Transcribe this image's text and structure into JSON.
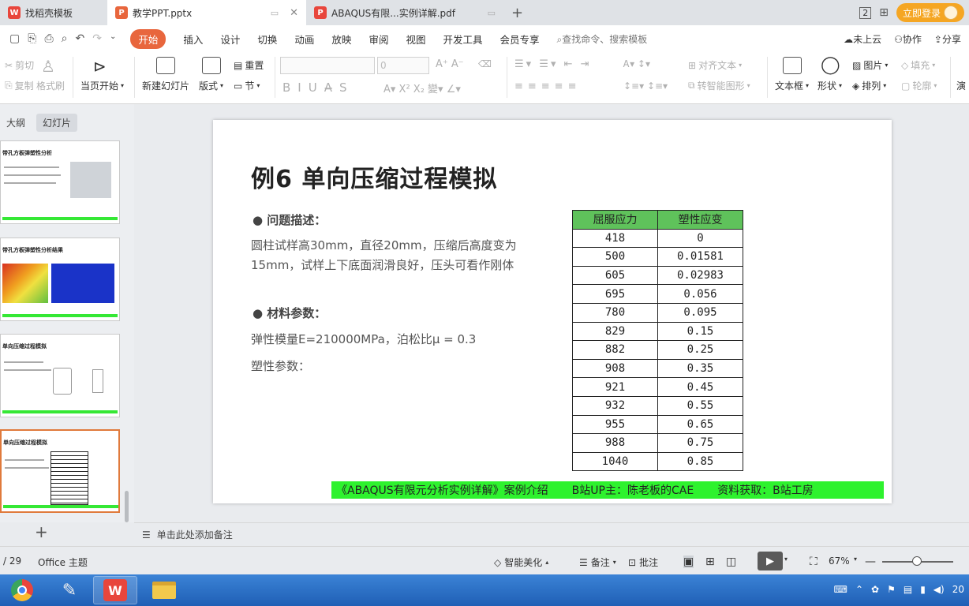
{
  "tabs": [
    {
      "label": "找稻壳模板",
      "icon": "wps-docer-icon",
      "color": "#e8463c"
    },
    {
      "label": "教学PPT.pptx",
      "icon": "ppt-file-icon",
      "color": "#e8663d"
    },
    {
      "label": "ABAQUS有限...实例详解.pdf",
      "icon": "pdf-file-icon",
      "color": "#e8463c"
    }
  ],
  "window": {
    "page_indicator": "2",
    "login_label": "立即登录"
  },
  "menu": {
    "items": [
      "开始",
      "插入",
      "设计",
      "切换",
      "动画",
      "放映",
      "审阅",
      "视图",
      "开发工具",
      "会员专享"
    ],
    "search_placeholder": "查找命令、搜索模板",
    "right": [
      "未上云",
      "协作",
      "分享"
    ]
  },
  "ribbon": {
    "clipboard": [
      "剪切",
      "复制",
      "格式刷"
    ],
    "start_from_current": "当页开始",
    "new_slide": "新建幻灯片",
    "layout": "版式",
    "reset": "重置",
    "section": "节",
    "font_size_value": "0",
    "align_text": "对齐文本",
    "to_smartart": "转智能图形",
    "textbox": "文本框",
    "shape": "形状",
    "picture": "图片",
    "arrange": "排列",
    "fill": "填充",
    "outline": "轮廓",
    "more": "演"
  },
  "left_panel": {
    "tabs": [
      "大纲",
      "幻灯片"
    ],
    "thumb_titles": [
      "带孔方板弹塑性分析",
      "带孔方板弹塑性分析结果",
      "单向压缩过程模拟",
      "单向压缩过程模拟"
    ]
  },
  "slide": {
    "title": "例6  单向压缩过程模拟",
    "bullet1": "● 问题描述：",
    "desc": "圆柱试样高30mm，直径20mm，压缩后高度变为15mm，试样上下底面润滑良好，压头可看作刚体",
    "bullet2": "● 材料参数：",
    "elastic": "弹性模量E=210000MPa，泊松比μ = 0.3",
    "plastic": "塑性参数：",
    "table": {
      "headers": [
        "屈服应力",
        "塑性应变"
      ],
      "rows": [
        [
          "418",
          "0"
        ],
        [
          "500",
          "0.01581"
        ],
        [
          "605",
          "0.02983"
        ],
        [
          "695",
          "0.056"
        ],
        [
          "780",
          "0.095"
        ],
        [
          "829",
          "0.15"
        ],
        [
          "882",
          "0.25"
        ],
        [
          "908",
          "0.35"
        ],
        [
          "921",
          "0.45"
        ],
        [
          "932",
          "0.55"
        ],
        [
          "955",
          "0.65"
        ],
        [
          "988",
          "0.75"
        ],
        [
          "1040",
          "0.85"
        ]
      ]
    },
    "footer": [
      "《ABAQUS有限元分析实例详解》案例介绍",
      "B站UP主：陈老板的CAE",
      "资料获取：B站工房"
    ]
  },
  "notes_placeholder": "单击此处添加备注",
  "status": {
    "page": "/ 29",
    "theme": "Office 主题",
    "beautify": "智能美化",
    "notes": "备注",
    "comment": "批注",
    "zoom": "67%"
  },
  "taskbar": {
    "clock": "20"
  }
}
